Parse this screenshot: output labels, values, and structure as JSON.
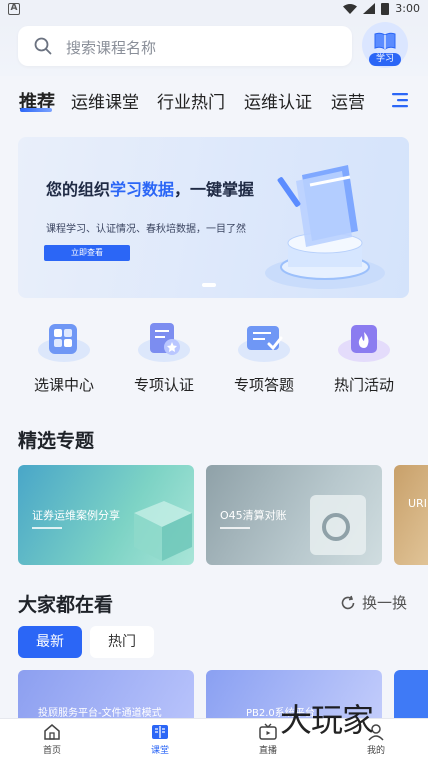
{
  "status_bar": {
    "time": "3:00",
    "left_badge": "A"
  },
  "search": {
    "placeholder": "搜索课程名称"
  },
  "learn_button": {
    "label": "学习"
  },
  "tabs": [
    "推荐",
    "运维课堂",
    "行业热门",
    "运维认证",
    "运营"
  ],
  "banner": {
    "title_a": "您的组织",
    "title_hl": "学习数据",
    "title_b": "，一键掌握",
    "subtitle": "课程学习、认证情况、春秋培数据，一目了然",
    "cta": "立即查看"
  },
  "quick_entries": [
    "选课中心",
    "专项认证",
    "专项答题",
    "热门活动"
  ],
  "featured": {
    "title": "精选专题",
    "items": [
      "证券运维案例分享",
      "O45清算对账",
      "URI"
    ]
  },
  "watching": {
    "title": "大家都在看",
    "swap_label": "换一换",
    "segments": [
      "最新",
      "热门"
    ],
    "cards": [
      "投顾服务平台-文件通道模式",
      "PB2.0系统平台"
    ]
  },
  "bottom_nav": [
    "首页",
    "课堂",
    "直播",
    "我的"
  ],
  "watermark": "大玩家",
  "colors": {
    "accent": "#2b66f6",
    "background": "#f3f5fa"
  }
}
